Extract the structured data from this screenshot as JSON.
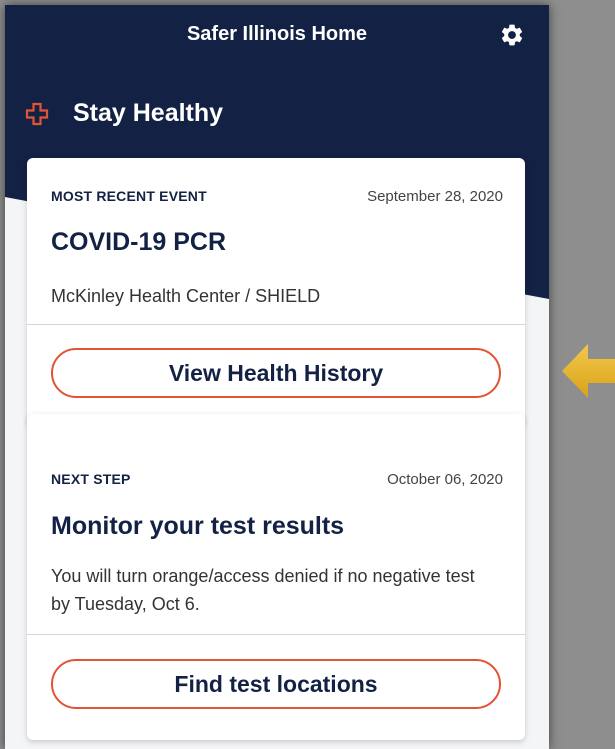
{
  "header": {
    "title": "Safer Illinois Home",
    "settings_icon": "gear-icon"
  },
  "section": {
    "title": "Stay Healthy",
    "icon": "medical-cross-icon",
    "icon_color": "#e35335"
  },
  "cards": [
    {
      "label": "MOST RECENT EVENT",
      "date": "September 28, 2020",
      "title": "COVID-19 PCR",
      "body": "McKinley Health Center / SHIELD",
      "button_label": "View Health History"
    },
    {
      "label": "NEXT STEP",
      "date": "October 06, 2020",
      "title": "Monitor your test results",
      "body": "You will turn orange/access denied if no negative test by Tuesday, Oct 6.",
      "button_label": "Find test locations"
    }
  ],
  "annotation": {
    "icon": "arrow-left-icon",
    "color": "#e7b322"
  },
  "colors": {
    "navy": "#132144",
    "accent_orange": "#e35335",
    "background": "#f4f5f7"
  }
}
